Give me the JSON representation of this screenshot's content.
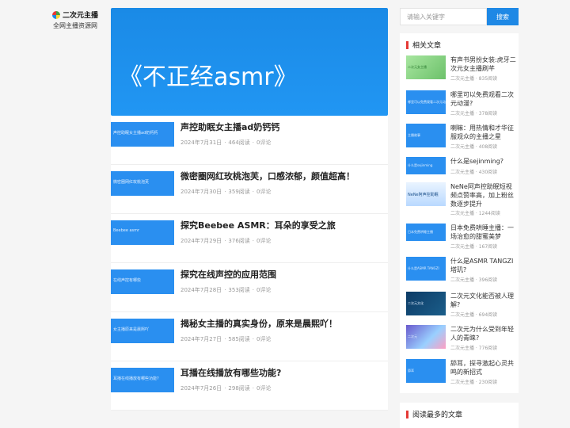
{
  "logo": {
    "title": "二次元主播",
    "subtitle": "全网主播资源网"
  },
  "hero": {
    "text": "《不正经asmr》"
  },
  "posts": [
    {
      "thumb": "声控助眠女主播ad奶钙钙",
      "title": "声控助眠女主播ad奶钙钙",
      "date": "2024年7月31日",
      "reads": "464阅读",
      "comments": "0评论"
    },
    {
      "thumb": "微密圈网红玫桃泡芙",
      "title": "微密圈网红玫桃泡芙，口感浓郁，颜值超高！",
      "date": "2024年7月30日",
      "reads": "359阅读",
      "comments": "0评论"
    },
    {
      "thumb": "Beebee asmr",
      "title": "探究Beebee ASMR：耳朵的享受之旅",
      "date": "2024年7月29日",
      "reads": "376阅读",
      "comments": "0评论"
    },
    {
      "thumb": "在线声控有哪些",
      "title": "探究在线声控的应用范围",
      "date": "2024年7月28日",
      "reads": "353阅读",
      "comments": "0评论"
    },
    {
      "thumb": "女主播原来是晨熙吖",
      "title": "揭秘女主播的真实身份，原来是晨熙吖！",
      "date": "2024年7月27日",
      "reads": "585阅读",
      "comments": "0评论"
    },
    {
      "thumb": "耳播在线播放有哪些功能?",
      "title": "耳播在线播放有哪些功能?",
      "date": "2024年7月26日",
      "reads": "298阅读",
      "comments": "0评论"
    }
  ],
  "search": {
    "placeholder": "请输入关键字",
    "button": "搜索"
  },
  "related": {
    "heading": "相关文章",
    "items": [
      {
        "thumb": "二次元女主播",
        "title": "有声书男扮女装:虎牙二次元女主播刷芊",
        "meta": "二次元主播 · 835阅读"
      },
      {
        "thumb": "哪里可以免费观看二次元动漫",
        "title": "哪里可以免费观看二次元动漫?",
        "meta": "二次元主播 · 378阅读"
      },
      {
        "thumb": "主播故事",
        "title": "喇嘛：用热情和才华征服观众的主播之星",
        "meta": "二次元主播 · 408阅读"
      },
      {
        "thumb": "什么是sejinming",
        "title": "什么是sejinming?",
        "meta": "二次元主播 · 430阅读"
      },
      {
        "thumb": "NeNe阿声控助眠",
        "title": "NeNe阿声控助眠短视频点赞率高，加上粉丝数逐步提升",
        "meta": "二次元主播 · 1244阅读"
      },
      {
        "thumb": "日本免费哄睡主播",
        "title": "日本免费哄睡主播：一场治愈的甜蜜美梦",
        "meta": "二次元主播 · 167阅读"
      },
      {
        "thumb": "什么是ASMR TANGZI",
        "title": "什么是ASMR TANGZI塔玑?",
        "meta": "二次元主播 · 396阅读"
      },
      {
        "thumb": "二次元文化",
        "title": "二次元文化能否被人理解?",
        "meta": "二次元主播 · 694阅读"
      },
      {
        "thumb": "二次元",
        "title": "二次元为什么受到年轻人的青睐?",
        "meta": "二次元主播 · 776阅读"
      },
      {
        "thumb": "舔耳",
        "title": "舔耳，探寻激起心灵共鸣的新招式",
        "meta": "二次元主播 · 230阅读"
      }
    ]
  },
  "popular": {
    "heading": "阅读最多的文章"
  }
}
